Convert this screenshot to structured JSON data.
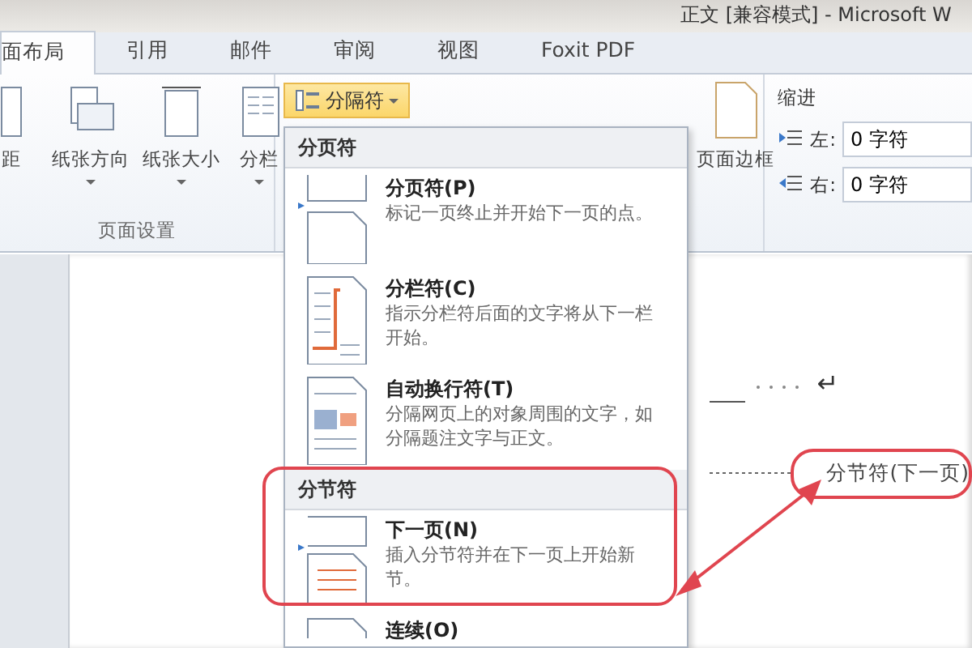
{
  "window": {
    "title": "正文 [兼容模式] - Microsoft W"
  },
  "tabs": [
    {
      "label": "面布局",
      "selected": true
    },
    {
      "label": "引用",
      "selected": false
    },
    {
      "label": "邮件",
      "selected": false
    },
    {
      "label": "审阅",
      "selected": false
    },
    {
      "label": "视图",
      "selected": false
    },
    {
      "label": "Foxit PDF",
      "selected": false
    }
  ],
  "ribbon": {
    "page_setup": {
      "label": "页面设置",
      "buttons": [
        {
          "label": "距",
          "kind": "margins",
          "dropdown": false
        },
        {
          "label": "纸张方向",
          "kind": "orientation",
          "dropdown": true
        },
        {
          "label": "纸张大小",
          "kind": "size",
          "dropdown": true
        },
        {
          "label": "分栏",
          "kind": "columns",
          "dropdown": true
        }
      ]
    },
    "breaks_button": {
      "label": "分隔符",
      "active": true
    },
    "page_border": {
      "label": "页面边框"
    },
    "indent": {
      "title": "缩进",
      "fields": [
        {
          "label": "左:",
          "value": "0 字符",
          "kind": "left"
        },
        {
          "label": "右:",
          "value": "0 字符",
          "kind": "right"
        }
      ]
    }
  },
  "menu": {
    "sections": [
      {
        "title": "分页符",
        "highlighted": false,
        "items": [
          {
            "title": "分页符(P)",
            "description": "标记一页终止并开始下一页的点。",
            "kind": "page-break"
          },
          {
            "title": "分栏符(C)",
            "description": "指示分栏符后面的文字将从下一栏开始。",
            "kind": "column-break"
          },
          {
            "title": "自动换行符(T)",
            "description": "分隔网页上的对象周围的文字，如分隔题注文字与正文。",
            "kind": "text-wrap"
          }
        ]
      },
      {
        "title": "分节符",
        "highlighted": true,
        "items": [
          {
            "title": "下一页(N)",
            "description": "插入分节符并在下一页上开始新节。",
            "kind": "next-page"
          },
          {
            "title": "连续(O)",
            "kind": "continuous"
          }
        ]
      }
    ]
  },
  "document": {
    "paragraph_mark": "↵",
    "section_break": "分节符(下一页)"
  }
}
